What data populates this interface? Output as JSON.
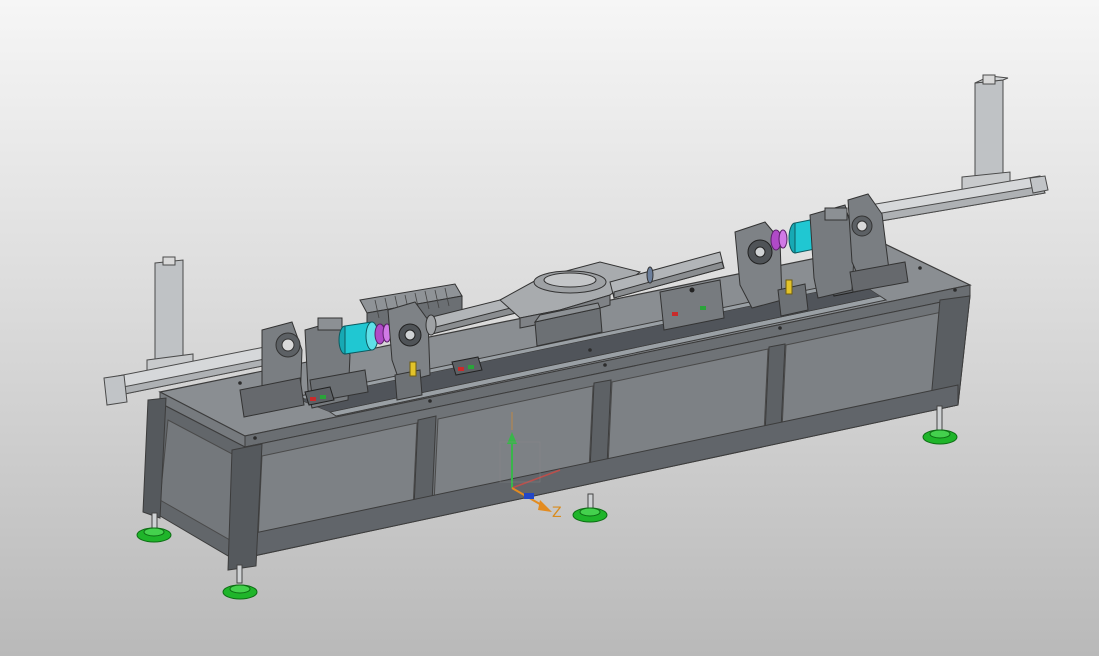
{
  "viewport": {
    "background_top": "#f6f6f6",
    "background_bottom": "#b9b9b9"
  },
  "model": {
    "frame_color": "#6f7377",
    "panel_color": "#7d8185",
    "foot_color": "#1fb52a",
    "flange_color": "#20c7d2",
    "accent_magenta": "#b04ac7",
    "rail_color": "#9aa0a5"
  },
  "triad": {
    "axis_label": "Z",
    "x_color": "#e0463f",
    "y_color": "#39b54a",
    "z_color": "#e38b1f"
  }
}
